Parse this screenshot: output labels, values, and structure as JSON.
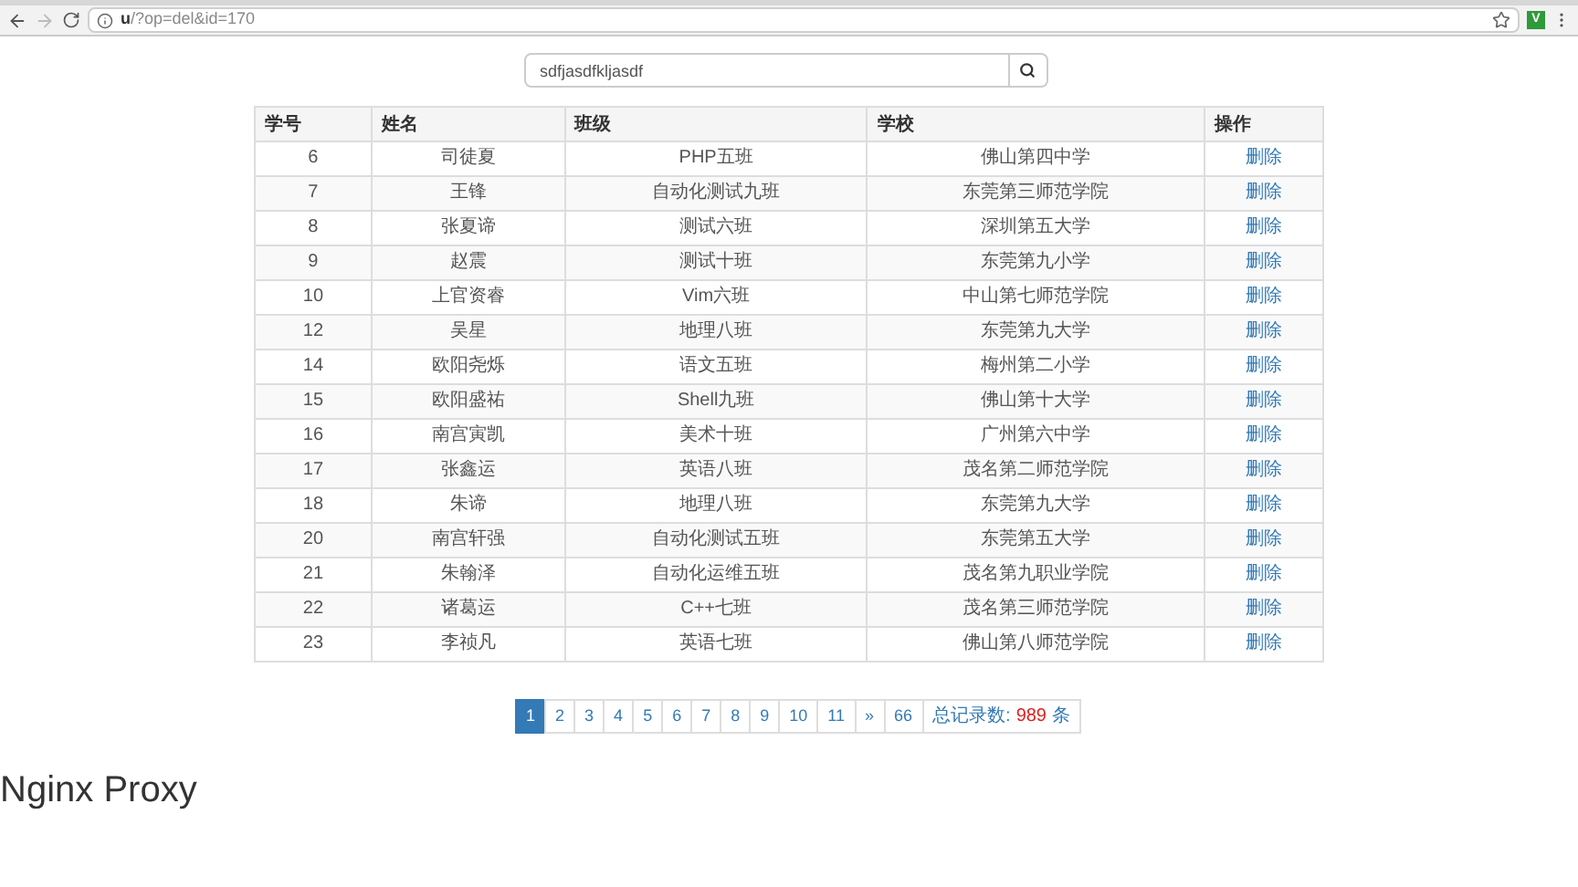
{
  "browser": {
    "back_disabled": false,
    "forward_disabled": true,
    "url_host": "u",
    "url_path": "/?op=del&id=170",
    "extension_label": "V"
  },
  "search": {
    "value": "sdfjasdfkljasdf"
  },
  "table": {
    "columns": [
      "学号",
      "姓名",
      "班级",
      "学校",
      "操作"
    ],
    "rows": [
      {
        "id": "6",
        "name": "司徒夏",
        "class": "PHP五班",
        "school": "佛山第四中学",
        "action": "删除"
      },
      {
        "id": "7",
        "name": "王锋",
        "class": "自动化测试九班",
        "school": "东莞第三师范学院",
        "action": "删除"
      },
      {
        "id": "8",
        "name": "张夏谛",
        "class": "测试六班",
        "school": "深圳第五大学",
        "action": "删除"
      },
      {
        "id": "9",
        "name": "赵震",
        "class": "测试十班",
        "school": "东莞第九小学",
        "action": "删除"
      },
      {
        "id": "10",
        "name": "上官资睿",
        "class": "Vim六班",
        "school": "中山第七师范学院",
        "action": "删除"
      },
      {
        "id": "12",
        "name": "吴星",
        "class": "地理八班",
        "school": "东莞第九大学",
        "action": "删除"
      },
      {
        "id": "14",
        "name": "欧阳尧烁",
        "class": "语文五班",
        "school": "梅州第二小学",
        "action": "删除"
      },
      {
        "id": "15",
        "name": "欧阳盛祐",
        "class": "Shell九班",
        "school": "佛山第十大学",
        "action": "删除"
      },
      {
        "id": "16",
        "name": "南宫寅凯",
        "class": "美术十班",
        "school": "广州第六中学",
        "action": "删除"
      },
      {
        "id": "17",
        "name": "张鑫运",
        "class": "英语八班",
        "school": "茂名第二师范学院",
        "action": "删除"
      },
      {
        "id": "18",
        "name": "朱谛",
        "class": "地理八班",
        "school": "东莞第九大学",
        "action": "删除"
      },
      {
        "id": "20",
        "name": "南宫轩强",
        "class": "自动化测试五班",
        "school": "东莞第五大学",
        "action": "删除"
      },
      {
        "id": "21",
        "name": "朱翰泽",
        "class": "自动化运维五班",
        "school": "茂名第九职业学院",
        "action": "删除"
      },
      {
        "id": "22",
        "name": "诸葛运",
        "class": "C++七班",
        "school": "茂名第三师范学院",
        "action": "删除"
      },
      {
        "id": "23",
        "name": "李祯凡",
        "class": "英语七班",
        "school": "佛山第八师范学院",
        "action": "删除"
      }
    ]
  },
  "pagination": {
    "pages": [
      {
        "label": "1",
        "selected": true
      },
      {
        "label": "2",
        "selected": false
      },
      {
        "label": "3",
        "selected": false
      },
      {
        "label": "4",
        "selected": false
      },
      {
        "label": "5",
        "selected": false
      },
      {
        "label": "6",
        "selected": false
      },
      {
        "label": "7",
        "selected": false
      },
      {
        "label": "8",
        "selected": false
      },
      {
        "label": "9",
        "selected": false
      },
      {
        "label": "10",
        "selected": false
      },
      {
        "label": "11",
        "selected": false
      },
      {
        "label": "»",
        "selected": false
      },
      {
        "label": "66",
        "selected": false
      }
    ],
    "total_label": "总记录数:",
    "total_count": "989",
    "total_unit": "条"
  },
  "footer_heading": "Nginx Proxy"
}
